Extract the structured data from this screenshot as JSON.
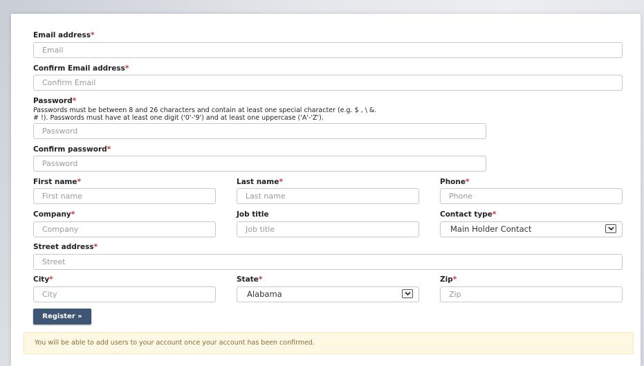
{
  "fields": {
    "email": {
      "label": "Email address",
      "required": "*",
      "placeholder": "Email"
    },
    "confirm_email": {
      "label": "Confirm Email address",
      "required": "*",
      "placeholder": "Confirm Email"
    },
    "password": {
      "label": "Password",
      "required": "*",
      "placeholder": "Password",
      "help_line1": "Passwords must be between 8 and 26 characters and contain at least one special character (e.g. $ , \\ &.",
      "help_line2": "# !). Passwords must have at least one digit ('0'-'9') and at least one uppercase ('A'-'Z')."
    },
    "confirm_password": {
      "label": "Confirm password",
      "required": "*",
      "placeholder": "Password"
    },
    "first_name": {
      "label": "First name",
      "required": "*",
      "placeholder": "First name"
    },
    "last_name": {
      "label": "Last name",
      "required": "*",
      "placeholder": "Last name"
    },
    "phone": {
      "label": "Phone",
      "required": "*",
      "placeholder": "Phone"
    },
    "company": {
      "label": "Company",
      "required": "*",
      "placeholder": "Company"
    },
    "job_title": {
      "label": "Job title",
      "placeholder": "Job title"
    },
    "contact_type": {
      "label": "Contact type",
      "required": "*",
      "selected": "Main Holder Contact"
    },
    "street": {
      "label": "Street address",
      "required": "*",
      "placeholder": "Street"
    },
    "city": {
      "label": "City",
      "required": "*",
      "placeholder": "City"
    },
    "state": {
      "label": "State",
      "required": "*",
      "selected": "Alabama"
    },
    "zip": {
      "label": "Zip",
      "required": "*",
      "placeholder": "Zip"
    }
  },
  "register_button": "Register »",
  "notice": "You will be able to add users to your account once your account has been confirmed.",
  "colors": {
    "required": "#d9302c",
    "button": "#3e5574",
    "alert_bg": "#fcf8e3",
    "alert_text": "#8a6d3b"
  },
  "icons": {
    "select_arrow": "chevron-down-icon"
  }
}
